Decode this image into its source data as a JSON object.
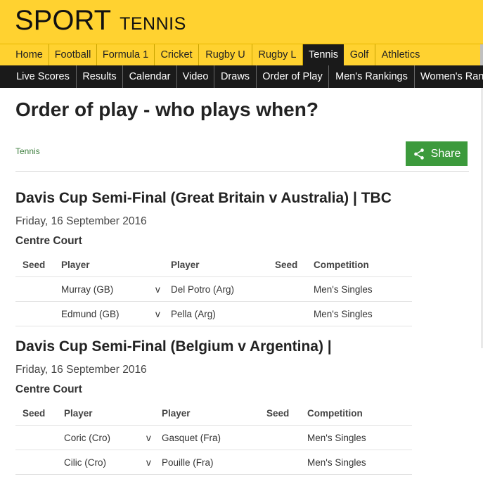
{
  "header": {
    "brand": "SPORT",
    "section": "TENNIS"
  },
  "nav_primary": [
    "Home",
    "Football",
    "Formula 1",
    "Cricket",
    "Rugby U",
    "Rugby L",
    "Tennis",
    "Golf",
    "Athletics"
  ],
  "nav_secondary": [
    "Live Scores",
    "Results",
    "Calendar",
    "Video",
    "Draws",
    "Order of Play",
    "Men's Rankings",
    "Women's Ran"
  ],
  "page": {
    "title": "Order of play - who plays when?",
    "breadcrumb": "Tennis",
    "share_label": "Share"
  },
  "table_headers": {
    "seed": "Seed",
    "player": "Player",
    "competition": "Competition"
  },
  "sections": [
    {
      "title": "Davis Cup Semi-Final (Great Britain v Australia) | TBC",
      "date": "Friday, 16 September 2016",
      "court": "Centre Court",
      "matches": [
        {
          "seed1": "",
          "player1": "Murray (GB)",
          "vs": "v",
          "player2": "Del Potro (Arg)",
          "seed2": "",
          "competition": "Men's Singles"
        },
        {
          "seed1": "",
          "player1": "Edmund (GB)",
          "vs": "v",
          "player2": "Pella (Arg)",
          "seed2": "",
          "competition": "Men's Singles"
        }
      ]
    },
    {
      "title": "Davis Cup Semi-Final (Belgium v Argentina) |",
      "date": "Friday, 16 September 2016",
      "court": "Centre Court",
      "matches": [
        {
          "seed1": "",
          "player1": "Coric (Cro)",
          "vs": "v",
          "player2": "Gasquet (Fra)",
          "seed2": "",
          "competition": "Men's Singles"
        },
        {
          "seed1": "",
          "player1": "Cilic (Cro)",
          "vs": "v",
          "player2": "Pouille (Fra)",
          "seed2": "",
          "competition": "Men's Singles"
        }
      ]
    }
  ],
  "colors": {
    "masthead": "#ffd230",
    "nav_dark": "#1a1a1a",
    "share_green": "#3c9a3c",
    "link_green": "#3f7f3f"
  }
}
